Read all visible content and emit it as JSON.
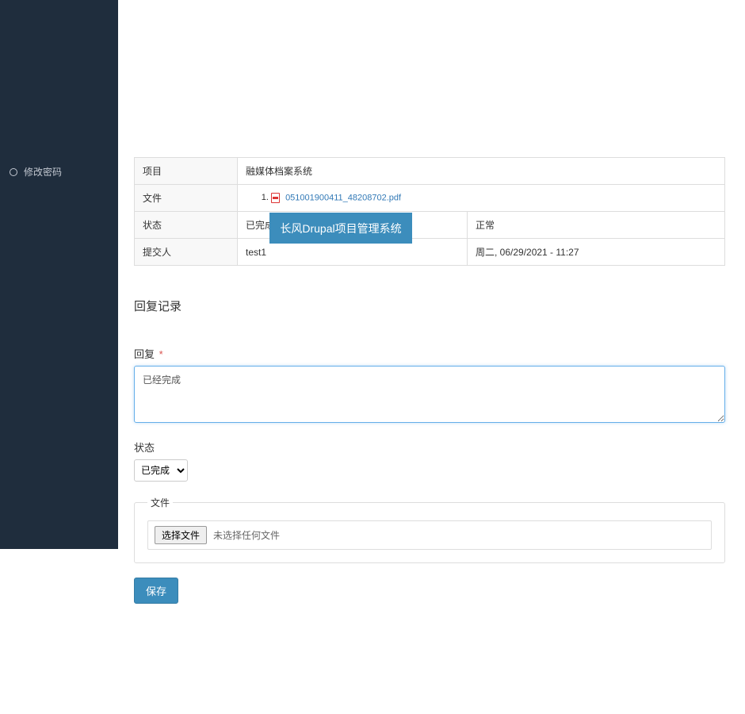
{
  "sidebar": {
    "items": [
      {
        "label": "修改密码"
      }
    ]
  },
  "info": {
    "project_label": "项目",
    "project_value": "融媒体档案系统",
    "file_label": "文件",
    "files": [
      {
        "name": "051001900411_48208702.pdf"
      }
    ],
    "status_label": "状态",
    "status_value": "已完成",
    "status2_value": "正常",
    "submitter_label": "提交人",
    "submitter_value": "test1",
    "submitted_value": "周二, 06/29/2021 - 11:27"
  },
  "banner": "长风Drupal项目管理系统",
  "headings": {
    "reply_history": "回复记录"
  },
  "form": {
    "reply_label": "回复",
    "reply_value": "已经完成",
    "status_label": "状态",
    "status_options": [
      "已完成"
    ],
    "status_selected": "已完成",
    "file_legend": "文件",
    "file_button": "选择文件",
    "file_status": "未选择任何文件",
    "save": "保存"
  }
}
